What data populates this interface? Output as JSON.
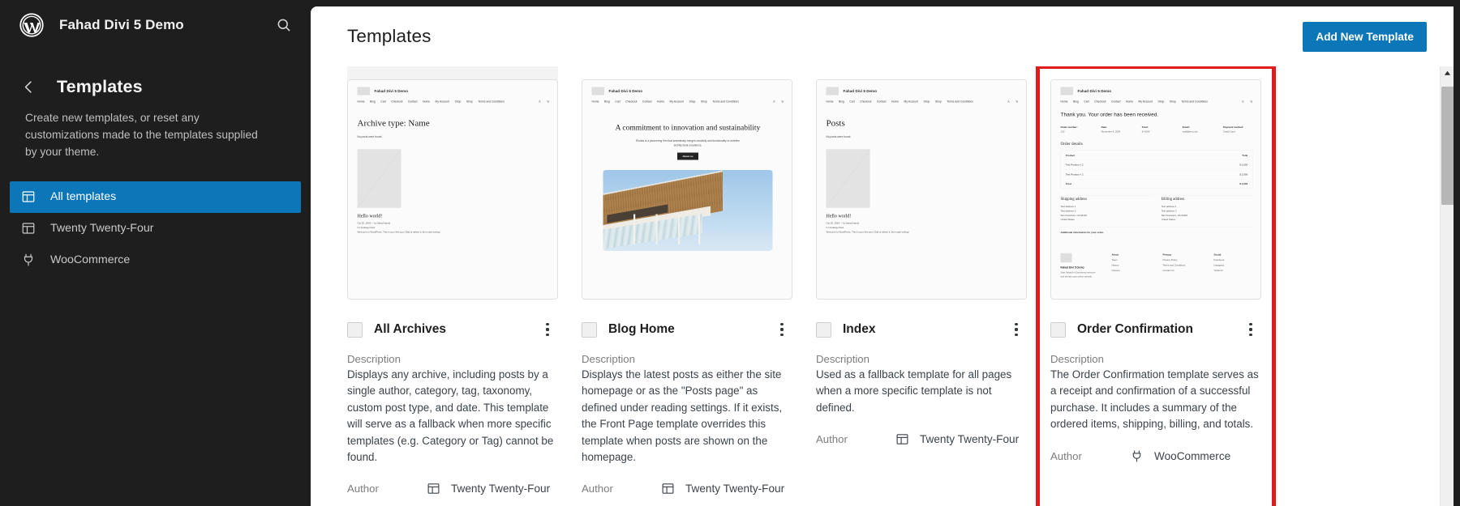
{
  "sidebar": {
    "site_title": "Fahad Divi 5 Demo",
    "search_icon": "search-icon",
    "wp_logo": "wordpress-logo",
    "back_label": "‹",
    "nav_title": "Templates",
    "nav_description": "Create new templates, or reset any customizations made to the templates supplied by your theme.",
    "items": [
      {
        "label": "All templates",
        "icon": "template-layout-icon",
        "active": true
      },
      {
        "label": "Twenty Twenty-Four",
        "icon": "template-layout-icon",
        "active": false
      },
      {
        "label": "WooCommerce",
        "icon": "plugin-plug-icon",
        "active": false
      }
    ]
  },
  "header": {
    "title": "Templates",
    "add_button": "Add New Template"
  },
  "labels": {
    "description": "Description",
    "author": "Author"
  },
  "preview_site": {
    "brand": "Fahad Divi 5 Demo",
    "nav": [
      "Home",
      "Blog",
      "Cart",
      "Checkout",
      "Contact",
      "Home",
      "My Account",
      "Shop",
      "Shop",
      "Terms and Conditions"
    ],
    "nav_icons": [
      "account-icon",
      "cart-icon"
    ]
  },
  "cards": [
    {
      "title": "All Archives",
      "description": "Displays any archive, including posts by a single author, category, tag, taxonomy, custom post type, and date. This template will serve as a fallback when more specific templates (e.g. Category or Tag) cannot be found.",
      "author": "Twenty Twenty-Four",
      "author_icon": "template-layout-icon",
      "highlighted": false,
      "preview": {
        "kind": "archive",
        "heading": "Archive type: Name",
        "subtext": "No posts were found.",
        "post_title": "Hello world!",
        "post_meta": "Oct 25, 2024 — by fahad hamid",
        "post_cat": "in Uncategorized",
        "post_excerpt": "Welcome to WordPress. This is your first post. Edit or delete it, then start writing!"
      }
    },
    {
      "title": "Blog Home",
      "description": "Displays the latest posts as either the site homepage or as the \"Posts page\" as defined under reading settings. If it exists, the Front Page template overrides this template when posts are shown on the homepage.",
      "author": "Twenty Twenty-Four",
      "author_icon": "template-layout-icon",
      "highlighted": false,
      "preview": {
        "kind": "hero",
        "heading": "A commitment to innovation and sustainability",
        "subtext": "Études is a pioneering firm that seamlessly merges creativity and functionality to redefine architectural excellence.",
        "button": "About us"
      }
    },
    {
      "title": "Index",
      "description": "Used as a fallback template for all pages when a more specific template is not defined.",
      "author": "Twenty Twenty-Four",
      "author_icon": "template-layout-icon",
      "highlighted": false,
      "preview": {
        "kind": "archive",
        "heading": "Posts",
        "subtext": "No posts were found.",
        "post_title": "Hello world!",
        "post_meta": "Oct 25, 2024 — by fahad hamid",
        "post_cat": "in Uncategorized",
        "post_excerpt": "Welcome to WordPress. This is your first post. Edit or delete it, then start writing!"
      }
    },
    {
      "title": "Order Confirmation",
      "description": "The Order Confirmation template serves as a receipt and confirmation of a successful purchase. It includes a summary of the ordered items, shipping, billing, and totals.",
      "author": "WooCommerce",
      "author_icon": "plugin-plug-icon",
      "highlighted": true,
      "preview": {
        "kind": "order",
        "heading": "Thank you. Your order has been received.",
        "summary": [
          {
            "label": "Order number:",
            "value": "123"
          },
          {
            "label": "Date:",
            "value": "November 4, 2024"
          },
          {
            "label": "Total:",
            "value": "$ 4,000"
          },
          {
            "label": "Email:",
            "value": "mail@test.com"
          },
          {
            "label": "Payment method:",
            "value": "Credit Card"
          }
        ],
        "details_heading": "Order details",
        "table_head": {
          "product": "Product",
          "total": "Total"
        },
        "table_rows": [
          {
            "product": "Test Product × 2",
            "total": "$ 2,000"
          },
          {
            "product": "Test Product × 2",
            "total": "$ 2,000"
          }
        ],
        "table_total": {
          "label": "Total",
          "value": "$ 4,000"
        },
        "shipping_heading": "Shipping address",
        "billing_heading": "Billing address",
        "address_lines": [
          "Test address 1",
          "Test address 2",
          "San Francisco, CA 94110",
          "United States"
        ],
        "note": "Additional information for your order.",
        "footer_brand": "Fahad Divi 5 Demo",
        "footer_tagline": "Start Fahad's eCommerce services and elevate your online website.",
        "footer_columns": [
          {
            "head": "About",
            "links": [
              "Team",
              "History",
              "Careers"
            ]
          },
          {
            "head": "Privacy",
            "links": [
              "Privacy Policy",
              "Terms and Conditions",
              "Contact Us"
            ]
          },
          {
            "head": "Social",
            "links": [
              "Facebook",
              "Instagram",
              "Twitter/X"
            ]
          }
        ]
      }
    }
  ],
  "highlight_color": "#e01b1b",
  "accent_color": "#0b76b8",
  "scrollbar": {
    "up_arrow": "chevron-up-icon",
    "thumb": "scroll-thumb"
  }
}
